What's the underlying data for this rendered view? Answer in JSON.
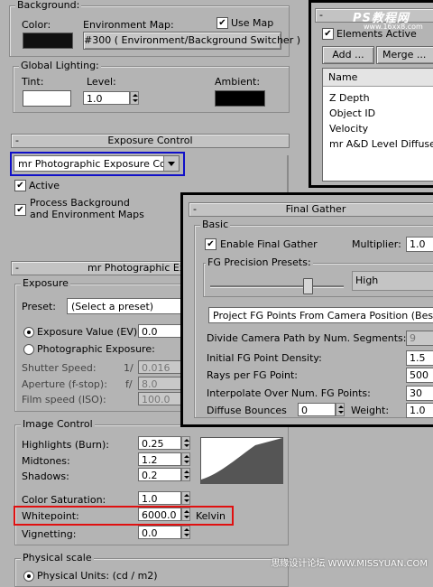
{
  "background_group": {
    "title": "Background:",
    "color_label": "Color:",
    "env_map_label": "Environment Map:",
    "use_map_label": "Use Map",
    "use_map_checked": true,
    "env_map_button": "#300 ( Environment/Background Switcher )",
    "color_swatch": "#101010"
  },
  "global_lighting": {
    "title": "Global Lighting:",
    "tint_label": "Tint:",
    "level_label": "Level:",
    "level_value": "1.0",
    "ambient_label": "Ambient:",
    "tint_swatch": "#ffffff",
    "ambient_swatch": "#000000"
  },
  "exposure_control": {
    "rollout_title": "Exposure Control",
    "rollout_marker": "-",
    "dropdown_value": "mr Photographic Exposure Contro",
    "active_label": "Active",
    "active_checked": true,
    "process_bg_label_1": "Process Background",
    "process_bg_label_2": "and Environment Maps",
    "process_bg_checked": true
  },
  "mr_photographic": {
    "rollout_title": "mr Photographic Exposu",
    "rollout_marker": "-",
    "exposure_group": "Exposure",
    "preset_label": "Preset:",
    "preset_value": "(Select a preset)",
    "ev_label": "Exposure Value (EV):",
    "ev_value": "0.0",
    "photo_exposure_label": "Photographic Exposure:",
    "shutter_label": "Shutter Speed:",
    "shutter_prefix": "1/",
    "shutter_value": "0.016",
    "aperture_label": "Aperture (f-stop):",
    "aperture_prefix": "f/",
    "aperture_value": "8.0",
    "film_label": "Film speed (ISO):",
    "film_value": "100.0",
    "image_control_group": "Image Control",
    "highlights_label": "Highlights (Burn):",
    "highlights_value": "0.25",
    "midtones_label": "Midtones:",
    "midtones_value": "1.2",
    "shadows_label": "Shadows:",
    "shadows_value": "0.2",
    "color_sat_label": "Color Saturation:",
    "color_sat_value": "1.0",
    "whitepoint_label": "Whitepoint:",
    "whitepoint_value": "6000.0",
    "whitepoint_unit": "Kelvin",
    "vignetting_label": "Vignetting:",
    "vignetting_value": "0.0",
    "physical_scale_group": "Physical scale",
    "physical_units_label": "Physical Units: (cd / m2)"
  },
  "render_elements": {
    "rollout_marker": "-",
    "elements_active_label": "Elements Active",
    "elements_active_checked": true,
    "add_button": "Add ...",
    "merge_button": "Merge ...",
    "list_header": "Name",
    "items": [
      "Z Depth",
      "Object ID",
      "Velocity",
      "mr A&D Level Diffuse"
    ]
  },
  "final_gather": {
    "rollout_title": "Final Gather",
    "rollout_marker": "-",
    "basic_group": "Basic",
    "enable_label": "Enable Final Gather",
    "enable_checked": true,
    "multiplier_label": "Multiplier:",
    "multiplier_value": "1.0",
    "presets_group": "FG Precision Presets:",
    "preset_value": "High",
    "slider_level": 0.72,
    "projection_value": "Project FG Points From Camera Position (Best for St",
    "divide_label": "Divide Camera Path by Num. Segments:",
    "divide_value": "9",
    "density_label": "Initial FG Point Density:",
    "density_value": "1.5",
    "rays_label": "Rays per FG Point:",
    "rays_value": "500",
    "interpolate_label": "Interpolate Over Num. FG Points:",
    "interpolate_value": "30",
    "bounces_label": "Diffuse Bounces",
    "bounces_value": "0",
    "weight_label": "Weight:",
    "weight_value": "1.0"
  },
  "watermark": {
    "top_logo": "PS教程网",
    "top_url": "www.16xx8.com",
    "bottom_text": "思缘设计论坛 WWW.MISSYUAN.COM"
  },
  "colors": {
    "panel_bg": "#b4b4b4",
    "highlight_blue": "#1010c8",
    "highlight_red": "#e01010",
    "window_border": "#000000"
  }
}
